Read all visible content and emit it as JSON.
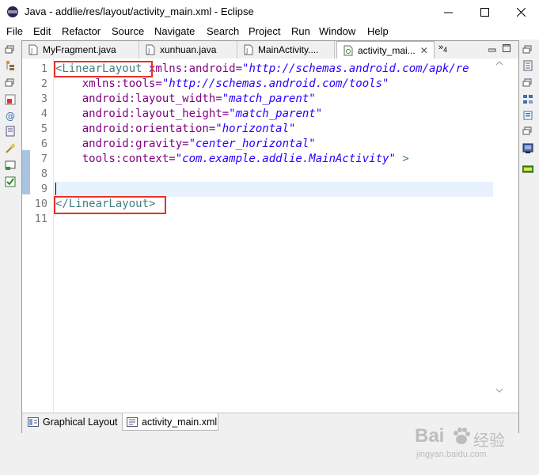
{
  "window": {
    "title": "Java - addlie/res/layout/activity_main.xml - Eclipse",
    "minimize": "—",
    "maximize": "☐",
    "close": "✕"
  },
  "menu": [
    "File",
    "Edit",
    "Refactor",
    "Source",
    "Navigate",
    "Search",
    "Project",
    "Run",
    "Window",
    "Help"
  ],
  "tabs": [
    {
      "label": "MyFragment.java",
      "icon": "java-file-icon"
    },
    {
      "label": "xunhuan.java",
      "icon": "java-file-icon"
    },
    {
      "label": "MainActivity....",
      "icon": "java-file-icon"
    },
    {
      "label": "activity_mai...",
      "icon": "xml-file-icon",
      "active": true
    }
  ],
  "tab_overflow": {
    "chevron": "»",
    "count": "4"
  },
  "code": {
    "line_numbers": [
      "1",
      "2",
      "3",
      "4",
      "5",
      "6",
      "7",
      "8",
      "9",
      "10",
      "11"
    ],
    "line1": {
      "tag": "<LinearLayout",
      "attr": " xmlns:android=",
      "val": "\"http://schemas.android.com/apk/re"
    },
    "line2": {
      "attr": "    xmlns:tools=",
      "val": "\"http://schemas.android.com/tools\""
    },
    "line3": {
      "attr": "    android:layout_width=",
      "val": "\"match_parent\""
    },
    "line4": {
      "attr": "    android:layout_height=",
      "val": "\"match_parent\""
    },
    "line5": {
      "attr": "    android:orientation=",
      "val": "\"horizontal\""
    },
    "line6": {
      "attr": "    android:gravity=",
      "val": "\"center_horizontal\""
    },
    "line7": {
      "attr": "    tools:context=",
      "val": "\"com.example.addlie.MainActivity\"",
      "tag_end": " >"
    },
    "line10": {
      "tag": "</LinearLayout>"
    }
  },
  "bottom_tabs": [
    {
      "label": "Graphical Layout",
      "icon": "graphical-layout-icon"
    },
    {
      "label": "activity_main.xml",
      "icon": "xml-source-icon",
      "active": true
    }
  ],
  "watermark": {
    "brand": "Bai",
    "brand_suffix": "经验",
    "domain": "jingyan.baidu.com"
  },
  "colors": {
    "tag": "#3f7f7f",
    "attr": "#7f007f",
    "value": "#2a00ff",
    "highlight_box": "#e8302a",
    "current_line": "#e8f2fe"
  }
}
